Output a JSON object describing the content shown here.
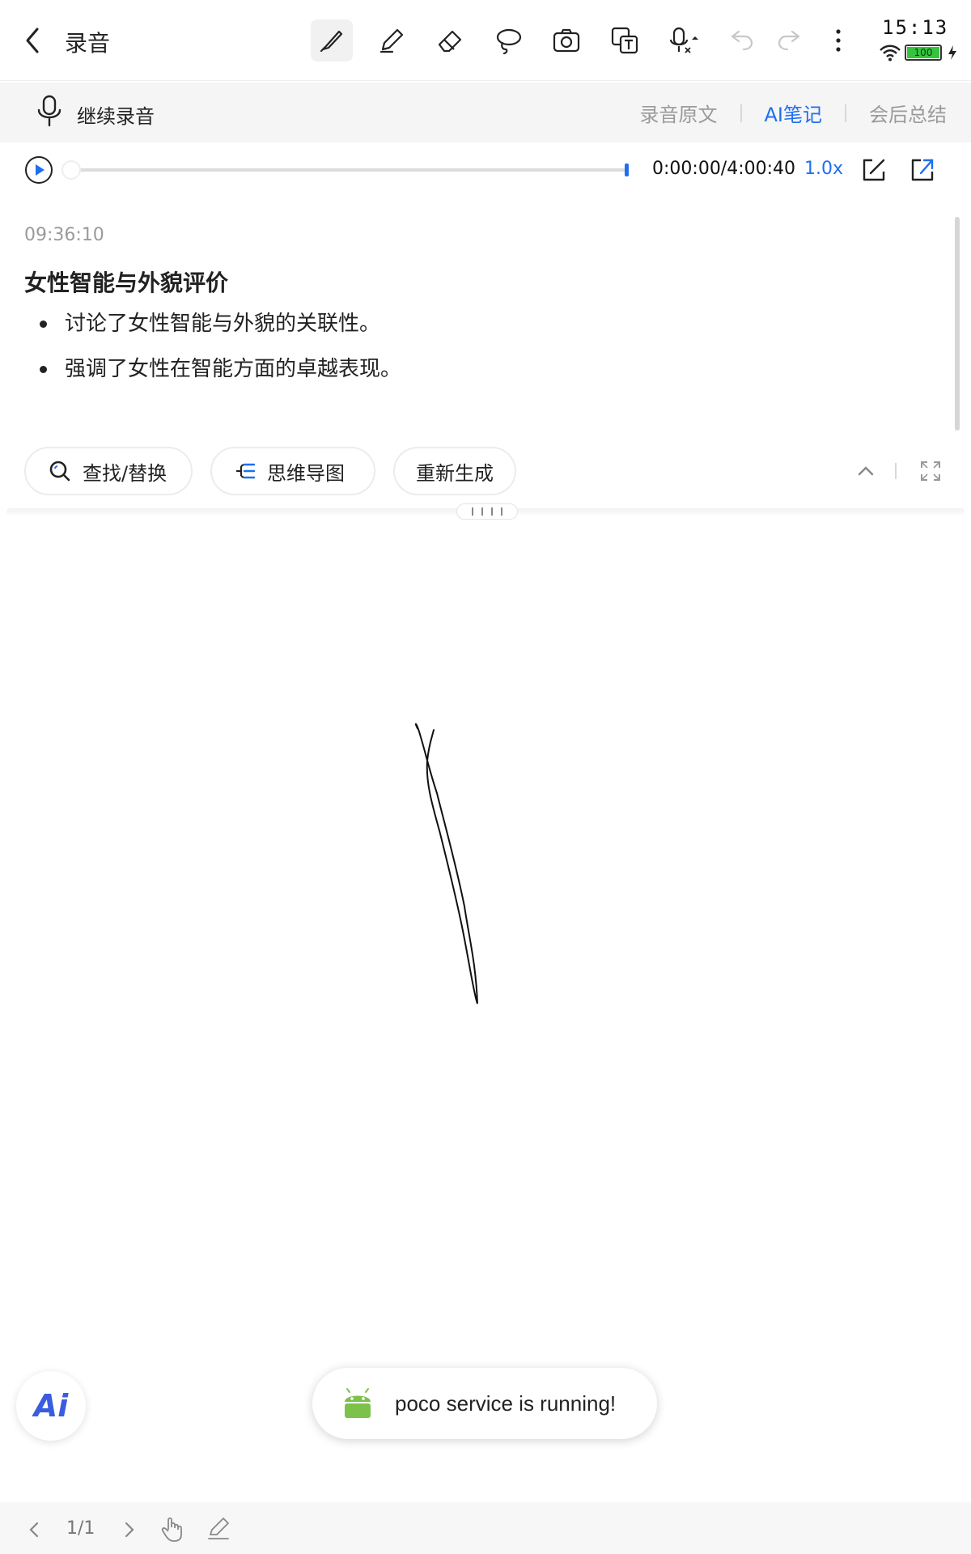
{
  "header": {
    "title": "录音",
    "time": "15:13",
    "battery": "100"
  },
  "toolbar": {
    "icons": [
      "brush-icon",
      "pencil-icon",
      "eraser-icon",
      "lasso-icon",
      "camera-icon",
      "text-convert-icon",
      "mic-to-text-icon",
      "undo-icon",
      "redo-icon",
      "more-icon"
    ]
  },
  "recording": {
    "continue_label": "继续录音",
    "tabs": [
      {
        "label": "录音原文",
        "active": false
      },
      {
        "label": "AI笔记",
        "active": true
      },
      {
        "label": "会后总结",
        "active": false
      }
    ]
  },
  "player": {
    "time": "0:00:00/4:00:40",
    "speed": "1.0x",
    "progress": 0.0
  },
  "note": {
    "timestamp": "09:36:10",
    "title": "女性智能与外貌评价",
    "bullets": [
      "讨论了女性智能与外貌的关联性。",
      "强调了女性在智能方面的卓越表现。"
    ]
  },
  "actions": {
    "find_replace": "查找/替换",
    "mind_map": "思维导图",
    "regenerate": "重新生成"
  },
  "ai_button": {
    "label": "Ai"
  },
  "toast": {
    "text": "poco service is running!"
  },
  "footer": {
    "page": "1/1"
  },
  "colors": {
    "accent": "#1e6ff0",
    "muted": "#9a9a9a"
  }
}
